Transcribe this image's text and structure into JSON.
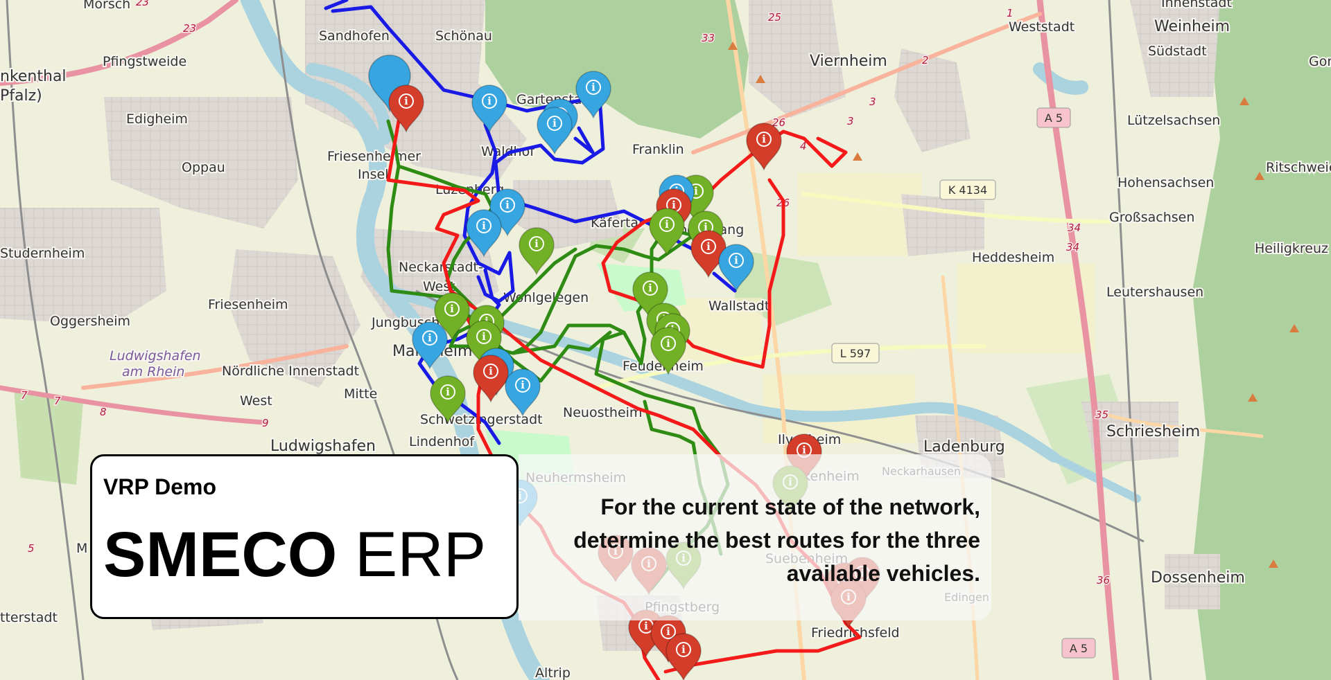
{
  "map": {
    "places": [
      {
        "name": "Morsch",
        "cls": "mid"
      },
      {
        "name": "Sandhofen",
        "cls": "mid"
      },
      {
        "name": "Schönau",
        "cls": "mid"
      },
      {
        "name": "nkenthal",
        "cls": "big"
      },
      {
        "name": "Pfalz)",
        "cls": "big"
      },
      {
        "name": "Pfingstweide",
        "cls": "mid"
      },
      {
        "name": "Edigheim",
        "cls": "mid"
      },
      {
        "name": "Oppau",
        "cls": "mid"
      },
      {
        "name": "Studernheim",
        "cls": "mid"
      },
      {
        "name": "Friesenheimer",
        "cls": "mid"
      },
      {
        "name": "Insel",
        "cls": "mid"
      },
      {
        "name": "Luzenberg",
        "cls": "mid"
      },
      {
        "name": "Gartenstadt",
        "cls": "mid"
      },
      {
        "name": "Waldhof",
        "cls": "mid"
      },
      {
        "name": "Franklin",
        "cls": "mid"
      },
      {
        "name": "Käfertal",
        "cls": "mid"
      },
      {
        "name": "Vogelstang",
        "cls": "mid"
      },
      {
        "name": "Neckarstadt-",
        "cls": "mid"
      },
      {
        "name": "West",
        "cls": "mid"
      },
      {
        "name": "Wohlgelegen",
        "cls": "mid"
      },
      {
        "name": "Wallstadt",
        "cls": "mid"
      },
      {
        "name": "Friesenheim",
        "cls": "mid"
      },
      {
        "name": "Oggersheim",
        "cls": "mid"
      },
      {
        "name": "Jungbusch",
        "cls": "mid"
      },
      {
        "name": "Mannheim",
        "cls": "big"
      },
      {
        "name": "Ludwigshafen",
        "cls": "mid italic"
      },
      {
        "name": "am Rhein",
        "cls": "mid italic"
      },
      {
        "name": "Nördliche Innenstadt",
        "cls": "mid"
      },
      {
        "name": "Feudenheim",
        "cls": "mid"
      },
      {
        "name": "Mitte",
        "cls": "mid"
      },
      {
        "name": "West",
        "cls": "mid"
      },
      {
        "name": "Schwetzingerstadt",
        "cls": "mid"
      },
      {
        "name": "Neuostheim",
        "cls": "mid"
      },
      {
        "name": "Ludwigshafen",
        "cls": "big"
      },
      {
        "name": "Lindenhof",
        "cls": "mid"
      },
      {
        "name": "Viernheim",
        "cls": "big"
      },
      {
        "name": "Weststadt",
        "cls": "mid"
      },
      {
        "name": "Weinheim",
        "cls": "big"
      },
      {
        "name": "Innenstadt",
        "cls": "mid"
      },
      {
        "name": "Südstadt",
        "cls": "mid"
      },
      {
        "name": "Gorx",
        "cls": "mid"
      },
      {
        "name": "Lützelsachsen",
        "cls": "mid"
      },
      {
        "name": "Hohensachsen",
        "cls": "mid"
      },
      {
        "name": "Ritschweier",
        "cls": "mid"
      },
      {
        "name": "Großsachsen",
        "cls": "mid"
      },
      {
        "name": "Heddesheim",
        "cls": "mid"
      },
      {
        "name": "Heiligkreuz",
        "cls": "mid"
      },
      {
        "name": "Leutershausen",
        "cls": "mid"
      },
      {
        "name": "Ilvesheim",
        "cls": "mid"
      },
      {
        "name": "Ladenburg",
        "cls": "big"
      },
      {
        "name": "Schriesheim",
        "cls": "big"
      },
      {
        "name": "Seckenheim",
        "cls": "mid"
      },
      {
        "name": "Neckarhausen",
        "cls": "small"
      },
      {
        "name": "Neuhermsheim",
        "cls": "mid"
      },
      {
        "name": "Suebenheim",
        "cls": "mid"
      },
      {
        "name": "Edingen",
        "cls": "small"
      },
      {
        "name": "Pfingstberg",
        "cls": "mid"
      },
      {
        "name": "Friedrichsfeld",
        "cls": "mid"
      },
      {
        "name": "Dossenheim",
        "cls": "big"
      },
      {
        "name": "tterstadt",
        "cls": "mid"
      },
      {
        "name": "Altrip",
        "cls": "mid"
      },
      {
        "name": "M",
        "cls": "mid"
      }
    ],
    "road_numbers": [
      "23",
      "23",
      "25",
      "26",
      "26",
      "33",
      "1",
      "2",
      "3",
      "3",
      "4",
      "34",
      "34",
      "35",
      "36",
      "7",
      "7",
      "8",
      "9",
      "5"
    ],
    "shields": [
      "A 5",
      "K 4134",
      "L 597",
      "A 5"
    ],
    "route_colors": {
      "red": "#f41a1a",
      "green": "#2e8b14",
      "blue": "#1a1ae6"
    },
    "marker_glyph": "i"
  },
  "card": {
    "kicker": "VRP Demo",
    "brand_bold": "SMECO",
    "brand_light": " ERP"
  },
  "description": {
    "line1": "For the current state of the network,",
    "line2": "determine the best routes for the three",
    "line3": "available vehicles."
  }
}
